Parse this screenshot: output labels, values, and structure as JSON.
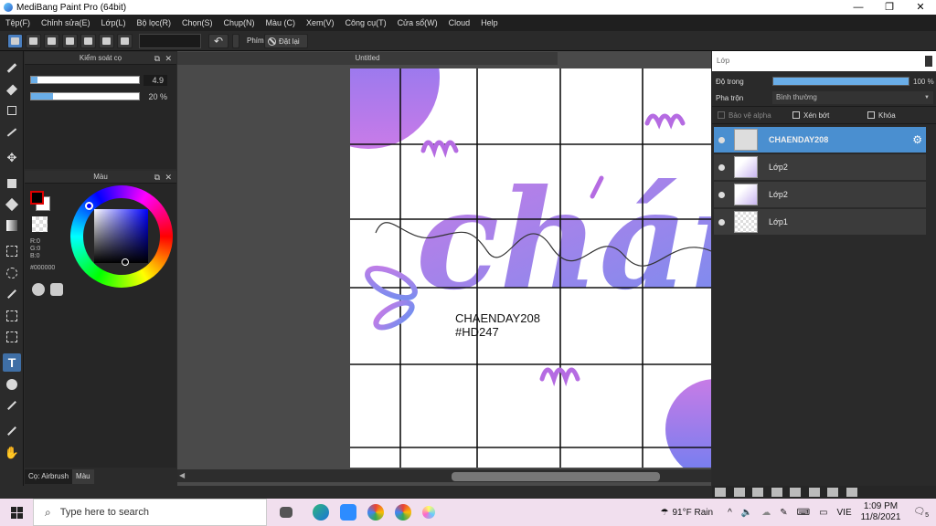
{
  "window": {
    "title": "MediBang Paint Pro (64bit)",
    "controls": [
      "—",
      "❐",
      "✕"
    ]
  },
  "menu": [
    "Tệp(F)",
    "Chỉnh sửa(E)",
    "Lớp(L)",
    "Bộ lọc(R)",
    "Chọn(S)",
    "Chụp(N)",
    "Màu (C)",
    "Xem(V)",
    "Công cụ(T)",
    "Cửa sổ(W)",
    "Cloud",
    "Help"
  ],
  "toolbar": {
    "key_label": "Phím",
    "reset_label": "Đặt lại"
  },
  "brush_control": {
    "title": "Kiểm soát cọ",
    "size_value": "4.9",
    "opacity_value": "20 %",
    "size_fraction": 0.06,
    "opacity_fraction": 0.2
  },
  "color_panel": {
    "title": "Màu",
    "r": "R:0",
    "g": "G:0",
    "b": "B:0",
    "hex": "#000000"
  },
  "bottom_tabs": {
    "brush_tab": "Cọ: Airbrush",
    "color_tab": "Màu"
  },
  "document": {
    "tab_title": "Untitled",
    "text_line1": "CHAENDAY208",
    "text_line2": "#HD247",
    "lettering": "chán"
  },
  "layer_panel": {
    "title": "Lớp",
    "opacity_label": "Độ trong",
    "opacity_value": "100 %",
    "blend_label": "Pha trộn",
    "blend_value": "Bình thường",
    "protect_alpha": "Bảo vệ alpha",
    "clipping": "Xén bớt",
    "lock": "Khóa",
    "layers": [
      "CHAENDAY208",
      "Lớp2",
      "Lớp2",
      "Lớp1"
    ]
  },
  "taskbar": {
    "search_placeholder": "Type here to search",
    "weather": "91°F  Rain",
    "lang": "VIE",
    "time": "1:09 PM",
    "date": "11/8/2021",
    "notifications": "5"
  },
  "colors": {
    "accent": "#4a8fd0",
    "purple": "#c77be6",
    "blue": "#6f8ff0",
    "taskbar": "#f1dfee"
  }
}
